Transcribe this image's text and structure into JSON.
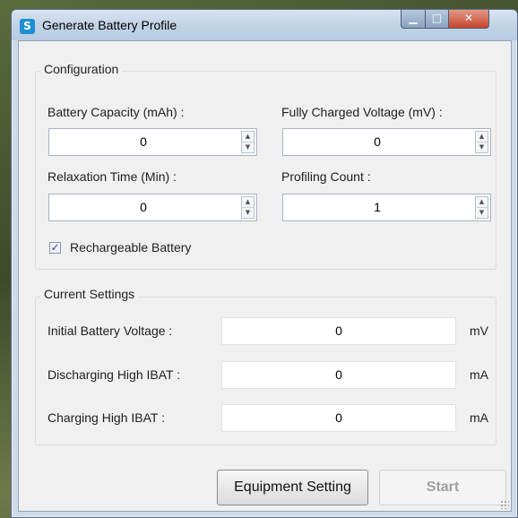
{
  "window": {
    "title": "Generate Battery Profile",
    "minimize_glyph": "▁",
    "maximize_glyph": "□",
    "close_glyph": "✕"
  },
  "configuration": {
    "group_title": "Configuration",
    "battery_capacity": {
      "label": "Battery Capacity (mAh) :",
      "value": "0"
    },
    "fully_charged_voltage": {
      "label": "Fully Charged Voltage (mV) :",
      "value": "0"
    },
    "relaxation_time": {
      "label": "Relaxation Time (Min) :",
      "value": "0"
    },
    "profiling_count": {
      "label": "Profiling Count :",
      "value": "1"
    },
    "rechargeable": {
      "label": "Rechargeable Battery",
      "checked": true,
      "check_glyph": "✓"
    }
  },
  "current_settings": {
    "group_title": "Current Settings",
    "initial_battery_voltage": {
      "label": "Initial Battery Voltage :",
      "value": "0",
      "unit": "mV"
    },
    "discharging_high_ibat": {
      "label": "Discharging High IBAT :",
      "value": "0",
      "unit": "mA"
    },
    "charging_high_ibat": {
      "label": "Charging High IBAT :",
      "value": "0",
      "unit": "mA"
    }
  },
  "buttons": {
    "equipment_setting": "Equipment Setting",
    "start": "Start"
  },
  "icons": {
    "app_icon": "S",
    "spin_up": "▲",
    "spin_down": "▼"
  }
}
